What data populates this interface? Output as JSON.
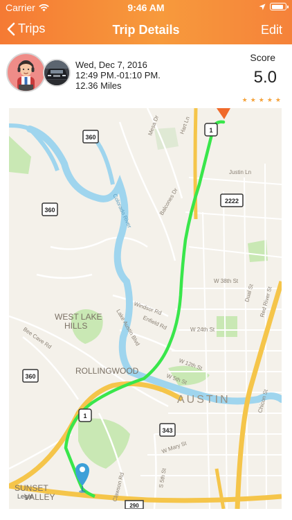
{
  "status_bar": {
    "carrier": "Carrier",
    "time": "9:46 AM"
  },
  "nav": {
    "back_label": "Trips",
    "title": "Trip Details",
    "edit_label": "Edit"
  },
  "trip": {
    "date": "Wed, Dec 7, 2016",
    "time_range": "12:49 PM.-01:10 PM.",
    "distance": "12.36 Miles",
    "score_label": "Score",
    "score_value": "5.0",
    "stars": "★★★★★"
  },
  "map": {
    "labels": {
      "west_lake_hills": "WEST LAKE",
      "west_lake_hills_2": "HILLS",
      "rollingwood": "ROLLINGWOOD",
      "austin": "AUSTIN",
      "sunset_valley": "SUNSET",
      "sunset_valley_2": "VALLEY",
      "legal": "Legal",
      "colorado_river": "Colorado River",
      "mesa_dr": "Mesa Dr",
      "hart_ln": "Hart Ln",
      "justin_ln": "Justin Ln",
      "balcones_dr": "Balcones Dr",
      "w38th": "W 38th St",
      "dual_st": "Dual St",
      "red_river": "Red River St",
      "windsor_rd": "Windsor Rd",
      "enfield_rd": "Enfield Rd",
      "w24th": "W 24th St",
      "lake_austin_blvd": "Lake Austin Blvd",
      "w12th": "W 12th St",
      "w5th": "W 5th St",
      "bee_cave_rd": "Bee Cave Rd",
      "chicon_st": "Chicon St",
      "w_mary_st": "W Mary St",
      "s5th": "S 5th St",
      "clawson_rd": "Clawson Rd"
    },
    "shields": {
      "hwy360_a": "360",
      "hwy360_b": "360",
      "hwy360_c": "360",
      "hwy2222": "2222",
      "hwy343": "343",
      "hwy290": "290",
      "hwy1_a": "1",
      "hwy1_b": "1"
    },
    "colors": {
      "route": "#39e64b",
      "river": "#9fd5ee",
      "highway": "#f5c54a",
      "park": "#c9e8b4",
      "pin": "#3da0d8",
      "dest": "#f06a2a"
    }
  }
}
